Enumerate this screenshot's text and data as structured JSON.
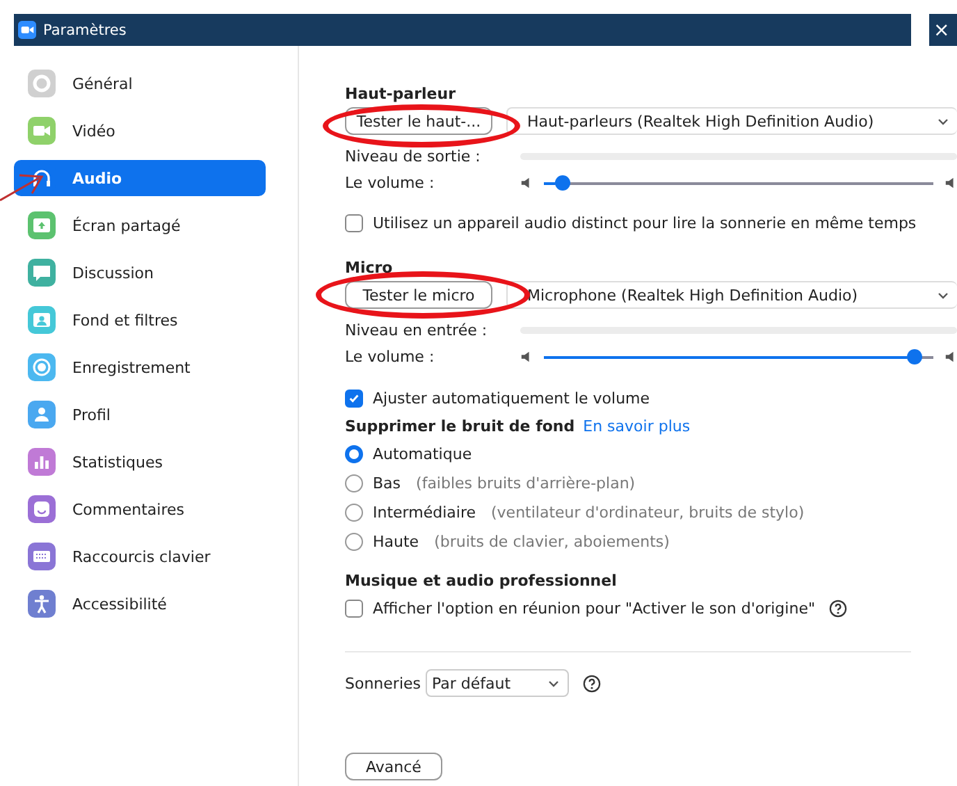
{
  "window": {
    "title": "Paramètres",
    "close": "×"
  },
  "sidebar": {
    "items": [
      {
        "label": "Général",
        "selected": false,
        "color": "#d0d0d0"
      },
      {
        "label": "Vidéo",
        "selected": false,
        "color": "#8fd16a"
      },
      {
        "label": "Audio",
        "selected": true,
        "color": "#0e72ed"
      },
      {
        "label": "Écran partagé",
        "selected": false,
        "color": "#5cc26f"
      },
      {
        "label": "Discussion",
        "selected": false,
        "color": "#3fb1a0"
      },
      {
        "label": "Fond et filtres",
        "selected": false,
        "color": "#45c8d8"
      },
      {
        "label": "Enregistrement",
        "selected": false,
        "color": "#4cb8f0"
      },
      {
        "label": "Profil",
        "selected": false,
        "color": "#4aa8f0"
      },
      {
        "label": "Statistiques",
        "selected": false,
        "color": "#c07ad6"
      },
      {
        "label": "Commentaires",
        "selected": false,
        "color": "#9b6fd6"
      },
      {
        "label": "Raccourcis clavier",
        "selected": false,
        "color": "#8a75d6"
      },
      {
        "label": "Accessibilité",
        "selected": false,
        "color": "#6f7fd0"
      }
    ]
  },
  "speaker": {
    "heading": "Haut-parleur",
    "test_button": "Tester le haut-...",
    "device": "Haut-parleurs (Realtek High Definition Audio)",
    "output_label": "Niveau de sortie :",
    "output": {
      "level": 0
    },
    "volume_label": "Le volume :",
    "volume": {
      "level": 0.03
    },
    "separate_device": {
      "label": "Utilisez un appareil audio distinct pour lire la sonnerie en même temps",
      "checked": false
    }
  },
  "micro": {
    "heading": "Micro",
    "test_button": "Tester le micro",
    "device": "Microphone (Realtek High Definition Audio)",
    "input_label": "Niveau en entrée :",
    "input": {
      "level": 0
    },
    "volume_label": "Le volume :",
    "volume": {
      "level": 0.97
    },
    "auto_adjust": {
      "label": "Ajuster automatiquement le volume",
      "checked": true
    }
  },
  "noise": {
    "heading": "Supprimer le bruit de fond",
    "link": "En savoir plus",
    "options": [
      {
        "label": "Automatique",
        "selected": true
      },
      {
        "label": "Bas",
        "hint": "(faibles bruits d'arrière-plan)",
        "selected": false
      },
      {
        "label": "Intermédiaire",
        "hint": "(ventilateur d'ordinateur, bruits de stylo)",
        "selected": false
      },
      {
        "label": "Haute",
        "hint": "(bruits de clavier, aboiements)",
        "selected": false
      }
    ]
  },
  "music": {
    "heading": "Musique et audio professionnel",
    "original_sound": {
      "label": "Afficher l'option en réunion pour \"Activer le son d'origine\"",
      "checked": false
    }
  },
  "ringtones": {
    "label": "Sonneries",
    "value": "Par défaut"
  },
  "advanced_button": "Avancé"
}
